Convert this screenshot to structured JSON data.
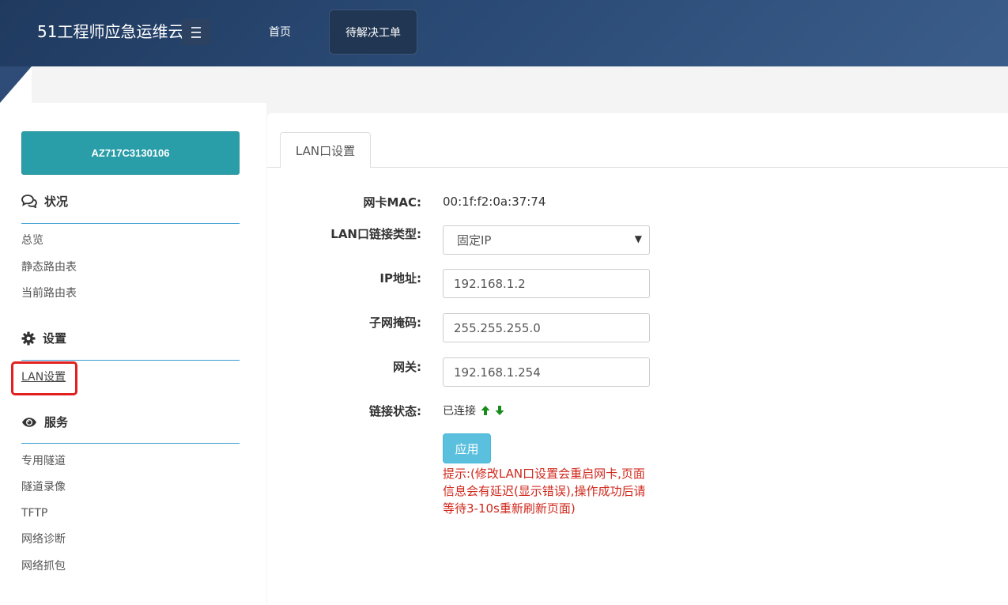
{
  "header": {
    "brand": "51工程师应急运维云",
    "nav": {
      "home": "首页",
      "pending": "待解决工单"
    }
  },
  "sidebar": {
    "device_id": "AZ717C3130106",
    "sections": [
      {
        "title": "状况",
        "icon": "comments-icon",
        "items": [
          "总览",
          "静态路由表",
          "当前路由表"
        ]
      },
      {
        "title": "设置",
        "icon": "gear-icon",
        "items": [
          "LAN设置"
        ]
      },
      {
        "title": "服务",
        "icon": "eye-icon",
        "items": [
          "专用隧道",
          "隧道录像",
          "TFTP",
          "网络诊断",
          "网络抓包"
        ]
      }
    ],
    "active_item": "LAN设置"
  },
  "main": {
    "tab": "LAN口设置",
    "form": {
      "mac_label": "网卡MAC:",
      "mac_value": "00:1f:f2:0a:37:74",
      "link_type_label": "LAN口链接类型:",
      "link_type_value": "固定IP",
      "ip_label": "IP地址:",
      "ip_value": "192.168.1.2",
      "mask_label": "子网掩码:",
      "mask_value": "255.255.255.0",
      "gateway_label": "网关:",
      "gateway_value": "192.168.1.254",
      "status_label": "链接状态:",
      "status_value": "已连接"
    },
    "apply_label": "应用",
    "tip": "提示:(修改LAN口设置会重启网卡,页面信息会有延迟(显示错误),操作成功后请等待3-10s重新刷新页面)"
  },
  "colors": {
    "accent_teal": "#2a9ea8",
    "apply_blue": "#5bc0de",
    "tip_red": "#d0281c",
    "status_green": "#1a8a1a",
    "highlight_red": "#e12020"
  }
}
